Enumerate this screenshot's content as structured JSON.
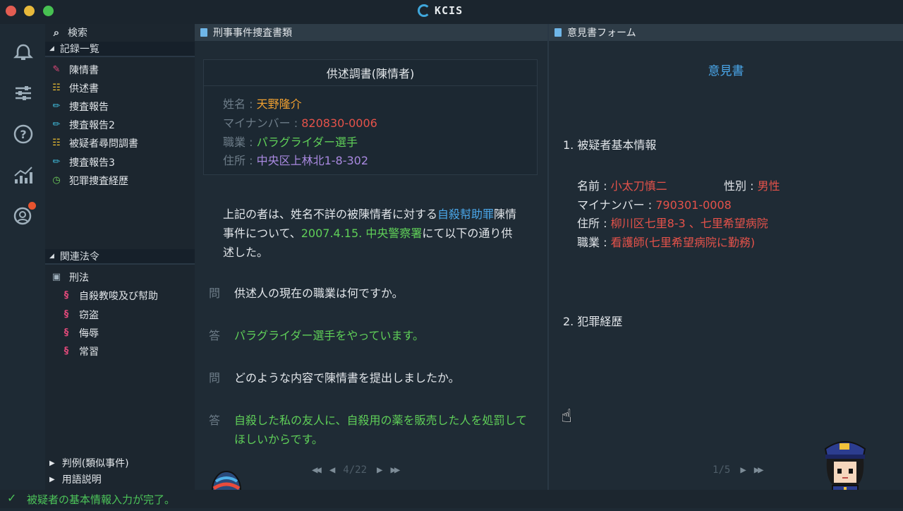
{
  "app": {
    "logo_text": "KCIS",
    "accent": "#3fa7dc"
  },
  "window_controls": {
    "close": "#e35d52",
    "minimize": "#e8b93b",
    "maximize": "#47c152"
  },
  "rail": {
    "icons": [
      "bell-icon",
      "sliders-icon",
      "help-icon",
      "chart-icon",
      "notification-person-icon"
    ]
  },
  "sidebar": {
    "search_label": "検索",
    "records_header": "記録一覧",
    "records": [
      {
        "label": "陳情書",
        "color": "#e0497a"
      },
      {
        "label": "供述書",
        "color": "#f1c232"
      },
      {
        "label": "捜査報告",
        "color": "#3fb9d9"
      },
      {
        "label": "捜査報告2",
        "color": "#3fb9d9"
      },
      {
        "label": "被疑者尋問調書",
        "color": "#f1c232"
      },
      {
        "label": "捜査報告3",
        "color": "#3fb9d9"
      },
      {
        "label": "犯罪捜査経歴",
        "color": "#6fcf5a"
      }
    ],
    "laws_header": "関連法令",
    "law_folder": "刑法",
    "laws": [
      "自殺教唆及び幇助",
      "窃盗",
      "侮辱",
      "常習"
    ],
    "precedent_label": "判例(類似事件)",
    "glossary_label": "用語説明"
  },
  "main": {
    "tab_title": "刑事事件捜査書類",
    "doc_title": "供述調書(陳情者)",
    "fields": [
      {
        "key": "姓名 : ",
        "value": "天野隆介",
        "color": "#f0a030"
      },
      {
        "key": "マイナンバー : ",
        "value": "820830-0006",
        "color": "#e5524a"
      },
      {
        "key": "職業 : ",
        "value": "パラグライダー選手",
        "color": "#5fcf58"
      },
      {
        "key": "住所 : ",
        "value": "中央区上林北1-8-302",
        "color": "#a989e0"
      }
    ],
    "intro": {
      "p1": "上記の者は、姓名不詳の被陳情者に対する",
      "p2": "自殺幇助罪",
      "p3": "陳情事件について、",
      "p4": "2007.4.15. 中央警察署",
      "p5": "にて以下の通り供述した。"
    },
    "qa": [
      {
        "tag": "問",
        "text": "供述人の現在の職業は何ですか。",
        "color": "#e2e6ea"
      },
      {
        "tag": "答",
        "text": "パラグライダー選手をやっています。",
        "color": "#5fcf58"
      },
      {
        "tag": "問",
        "text": "どのような内容で陳情書を提出しましたか。",
        "color": "#e2e6ea"
      },
      {
        "tag": "答",
        "text": "自殺した私の友人に、自殺用の薬を販売した人を処罰してほしいからです。",
        "color": "#5fcf58"
      }
    ],
    "pager": {
      "current": "4",
      "total": "22",
      "separator": "/"
    }
  },
  "opinion": {
    "tab_title": "意見書フォーム",
    "title": "意見書",
    "section1": "1. 被疑者基本情報",
    "name_key": "名前 : ",
    "name_val": "小太刀慎二",
    "sex_key": "性別 : ",
    "sex_val": "男性",
    "mynumber_key": "マイナンバー : ",
    "mynumber_val": "790301-0008",
    "address_key": "住所 : ",
    "address_val": "柳川区七里8-3 、七里希望病院",
    "job_key": "職業 : ",
    "job_val": "看護師(七里希望病院に勤務)",
    "section2": "2. 犯罪経歴",
    "pager": {
      "current": "1",
      "total": "5",
      "separator": "/"
    }
  },
  "status": {
    "text": "被疑者の基本情報入力が完了。",
    "color": "#4cc459"
  }
}
